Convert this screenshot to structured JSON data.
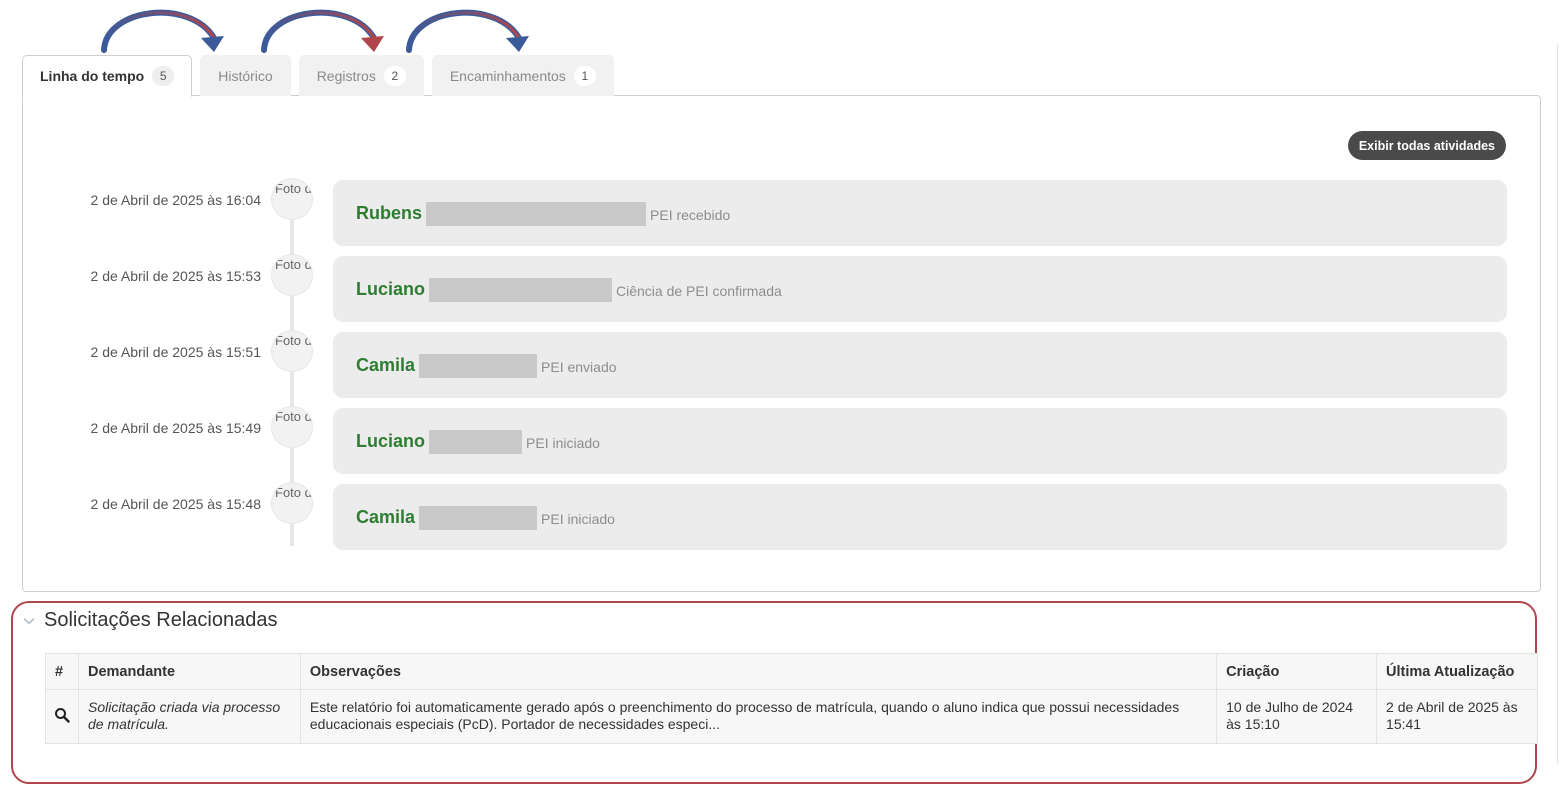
{
  "tabs": [
    {
      "label": "Linha do tempo",
      "count": "5",
      "active": true
    },
    {
      "label": "Histórico",
      "count": "",
      "active": false
    },
    {
      "label": "Registros",
      "count": "2",
      "active": false
    },
    {
      "label": "Encaminhamentos",
      "count": "1",
      "active": false
    }
  ],
  "timeline": {
    "show_all_label": "Exibir todas atividades",
    "avatar_alt": "Foto de perfil",
    "events": [
      {
        "date": "2 de Abril de 2025 às 16:04",
        "name": "Rubens",
        "action": "PEI recebido",
        "redact_width": 220
      },
      {
        "date": "2 de Abril de 2025 às 15:53",
        "name": "Luciano",
        "action": "Ciência de PEI confirmada",
        "redact_width": 183
      },
      {
        "date": "2 de Abril de 2025 às 15:51",
        "name": "Camila",
        "action": "PEI enviado",
        "redact_width": 118
      },
      {
        "date": "2 de Abril de 2025 às 15:49",
        "name": "Luciano",
        "action": "PEI iniciado",
        "redact_width": 93
      },
      {
        "date": "2 de Abril de 2025 às 15:48",
        "name": "Camila",
        "action": "PEI iniciado",
        "redact_width": 118
      }
    ]
  },
  "related": {
    "title": "Solicitações Relacionadas",
    "columns": {
      "num": "#",
      "demandante": "Demandante",
      "observacoes": "Observações",
      "criacao": "Criação",
      "atualizacao": "Última Atualização"
    },
    "rows": [
      {
        "demandante": "Solicitação criada via processo de matrícula.",
        "observacoes": "Este relatório foi automaticamente gerado após o preenchimento do processo de matrícula, quando o aluno indica que possui necessidades educacionais especiais (PcD). Portador de necessidades especi...",
        "criacao": "10 de Julho de 2024 às 15:10",
        "atualizacao": "2 de Abril de 2025 às 15:41"
      }
    ]
  },
  "colors": {
    "name_green": "#2e7d32",
    "annotation_red": "#b0464b",
    "arrow_blue": "#3b5a9a",
    "button_dark": "#4a4a4a"
  }
}
